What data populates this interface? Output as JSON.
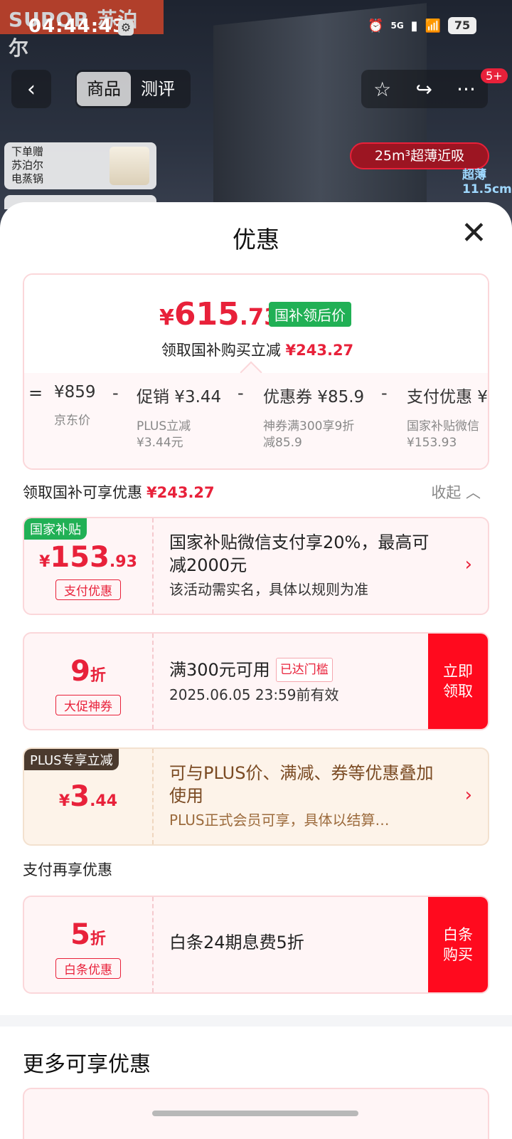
{
  "status_bar": {
    "time": "04:44:43",
    "network": "5G",
    "battery": "75"
  },
  "background": {
    "brand_logo": "SUPOR 苏泊尔",
    "feature_pill": "25m³超薄近吸",
    "thin_label": "超薄 11.5cm"
  },
  "nav": {
    "tabs": [
      "商品",
      "测评"
    ],
    "active_tab": "商品",
    "message_badge": "5+"
  },
  "gift_banner": {
    "text": "下单赠\n苏泊尔\n电蒸锅"
  },
  "sheet": {
    "title": "优惠",
    "price": {
      "symbol": "¥",
      "integer": "615",
      "decimal": ".73",
      "tag": "国补领后价"
    },
    "subtitle": {
      "text": "领取国补购买立减",
      "amount": "¥243.27"
    },
    "breakdown": [
      {
        "op": "=",
        "head": "¥859",
        "note": "京东价"
      },
      {
        "op": "-",
        "head": "促销 ¥3.44",
        "note": "PLUS立减\n¥3.44元"
      },
      {
        "op": "-",
        "head": "优惠券 ¥85.9",
        "note": "神券满300享9折\n减85.9"
      },
      {
        "op": "-",
        "head": "支付优惠 ¥",
        "note": "国家补贴微信\n¥153.93"
      }
    ],
    "section1": {
      "label": "领取国补可享优惠",
      "amount": "¥243.27",
      "fold": "收起"
    },
    "offers": [
      {
        "tag": "国家补贴",
        "symbol": "¥",
        "big": "153",
        "small": ".93",
        "label": "支付优惠",
        "title": "国家补贴微信支付享20%，最高可减2000元",
        "sub": "该活动需实名，具体以规则为准",
        "action": "arrow"
      },
      {
        "big": "9",
        "small": "折",
        "label": "大促神券",
        "title": "满300元可用",
        "reach_tag": "已达门槛",
        "sub": "2025.06.05 23:59前有效",
        "action": "立即\n领取"
      },
      {
        "tag": "PLUS专享立减",
        "symbol": "¥",
        "big": "3",
        "small": ".44",
        "title": "可与PLUS价、满减、券等优惠叠加使用",
        "sub": "PLUS正式会员可享，具体以结算…",
        "action": "arrow"
      }
    ],
    "section2": {
      "label": "支付再享优惠"
    },
    "pay_offer": {
      "big": "5",
      "small": "折",
      "label": "白条优惠",
      "title": "白条24期息费5折",
      "action": "白条\n购买"
    },
    "more_title": "更多可享优惠"
  },
  "colors": {
    "red": "#e8213a",
    "green": "#21b055",
    "button_red": "#ff0a1e"
  }
}
